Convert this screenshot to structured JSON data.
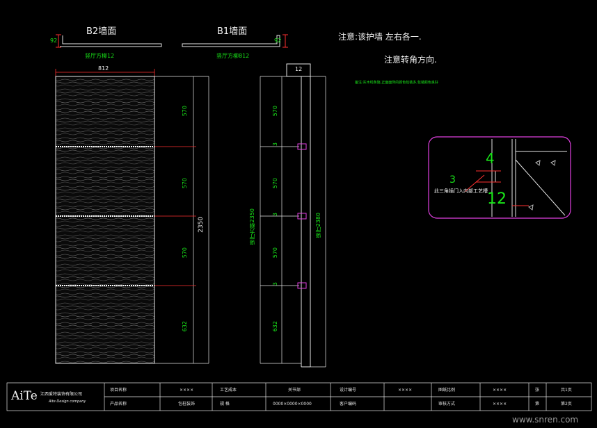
{
  "views": {
    "b2_title": "B2墙面",
    "b1_title": "B1墙面",
    "b2_thickness": "92",
    "b1_thickness": "92",
    "b2_label": "竖厅方柳12",
    "b1_label": "竖厅方柳812",
    "width_dim": "812",
    "side_dim": "12"
  },
  "notes": {
    "line1": "注意:该护墙  左右各一.",
    "line2": "注意转角方向.",
    "small": "备注:实木线条施,正面面饰的颜色包装多,包装颜色良好"
  },
  "front_dims": {
    "segments": [
      "570",
      "570",
      "570",
      "632"
    ],
    "total": "2350"
  },
  "side_dims": {
    "segments": [
      "570",
      "3",
      "570",
      "3",
      "570",
      "3",
      "632"
    ],
    "left_total": "竖厅方柳2350",
    "right_total": "竖厅2380"
  },
  "detail": {
    "label": "此三角插门入内部工艺槽",
    "num_top": "4",
    "num_bottom": "12",
    "mark": "3"
  },
  "title_block": {
    "logo_main": "AiTe",
    "company_cn": "江西爱特装饰有限公司",
    "company_en": "Aite Design company",
    "r1": [
      "项目名称",
      "××××",
      "工艺成本",
      "关节部",
      "设计编号",
      "××××",
      "图纸比例",
      "××××",
      "张",
      "共1页"
    ],
    "r2": [
      "产品名称",
      "包柱装饰",
      "规   格",
      "0000×0000×0000",
      "客户编码",
      "",
      "审核方式",
      "××××",
      "第",
      "第2页"
    ]
  },
  "watermark": "www.snren.com"
}
